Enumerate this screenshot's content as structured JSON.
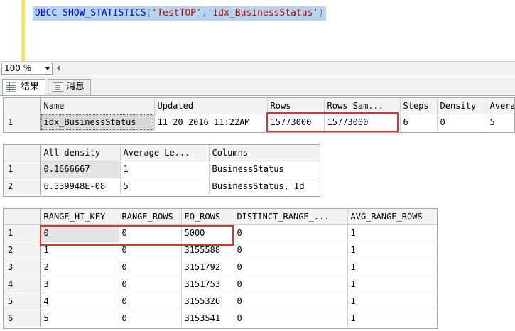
{
  "editor": {
    "query": {
      "keyword": "DBCC SHOW_STATISTICS",
      "open_paren": "(",
      "table": "'TestTOP'",
      "comma": ",",
      "index": "'idx_BusinessStatus'",
      "close_paren": ")"
    }
  },
  "zoom": {
    "value": "100 %"
  },
  "tabs": [
    {
      "label": "结果",
      "icon": "grid-icon",
      "active": true
    },
    {
      "label": "消息",
      "icon": "message-icon",
      "active": false
    }
  ],
  "grid1": {
    "headers": [
      "Name",
      "Updated",
      "Rows",
      "Rows Sam...",
      "Steps",
      "Density",
      "Avera"
    ],
    "rows": [
      {
        "n": "1",
        "cells": [
          "idx_BusinessStatus",
          "11 20 2016 11:22AM",
          "15773000",
          "15773000",
          "6",
          "0",
          "5"
        ]
      }
    ]
  },
  "grid2": {
    "headers": [
      "All density",
      "Average Le...",
      "Columns"
    ],
    "rows": [
      {
        "n": "1",
        "cells": [
          "0.1666667",
          "1",
          "BusinessStatus"
        ]
      },
      {
        "n": "2",
        "cells": [
          "6.339948E-08",
          "5",
          "BusinessStatus, Id"
        ]
      }
    ]
  },
  "grid3": {
    "headers": [
      "RANGE_HI_KEY",
      "RANGE_ROWS",
      "EQ_ROWS",
      "DISTINCT_RANGE_...",
      "AVG_RANGE_ROWS"
    ],
    "rows": [
      {
        "n": "1",
        "cells": [
          "0",
          "0",
          "5000",
          "0",
          "1"
        ]
      },
      {
        "n": "2",
        "cells": [
          "1",
          "0",
          "3155588",
          "0",
          "1"
        ]
      },
      {
        "n": "3",
        "cells": [
          "2",
          "0",
          "3151792",
          "0",
          "1"
        ]
      },
      {
        "n": "4",
        "cells": [
          "3",
          "0",
          "3151753",
          "0",
          "1"
        ]
      },
      {
        "n": "5",
        "cells": [
          "4",
          "0",
          "3155326",
          "0",
          "1"
        ]
      },
      {
        "n": "6",
        "cells": [
          "5",
          "0",
          "3153541",
          "0",
          "1"
        ]
      }
    ]
  },
  "colors": {
    "highlight": "#e03030",
    "selection": "#b5d4f0",
    "gutter": "#f5e36a"
  }
}
